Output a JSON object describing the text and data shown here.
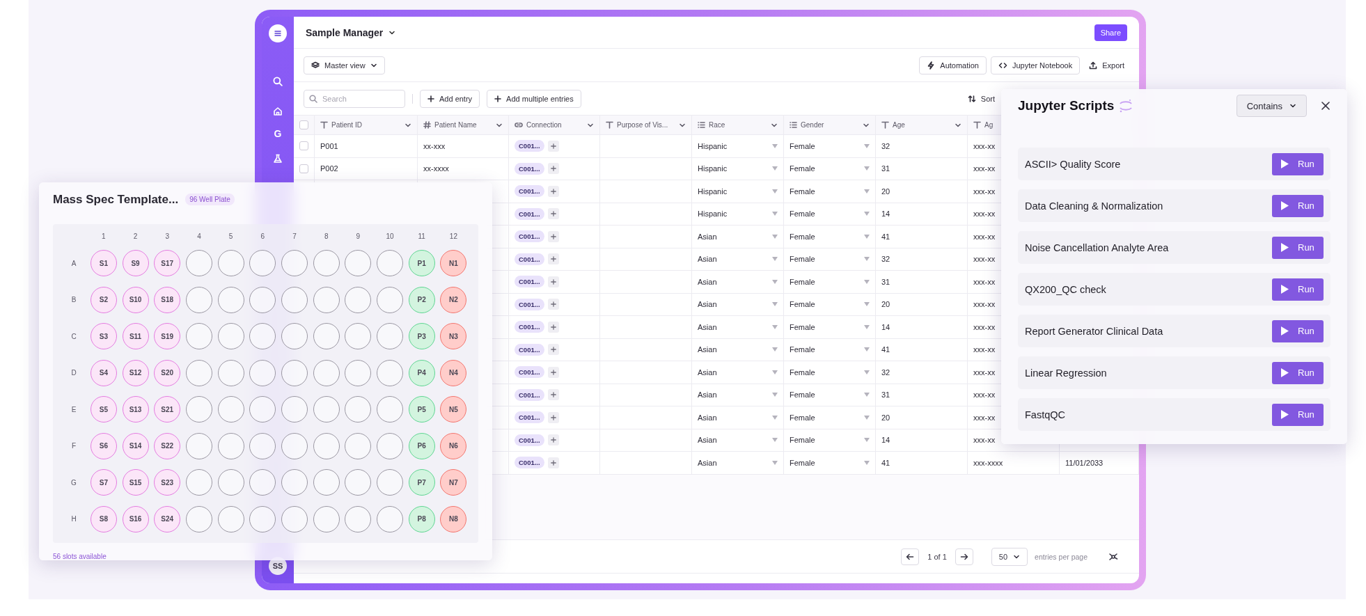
{
  "sidebar": {
    "letter": "G",
    "avatar": "SS"
  },
  "header": {
    "title": "Sample Manager",
    "share": "Share"
  },
  "toolbar": {
    "view": "Master view",
    "actions": [
      {
        "kind": "automation",
        "label": "Automation"
      },
      {
        "kind": "code",
        "label": "Jupyter Notebook"
      },
      {
        "kind": "export",
        "label": "Export"
      }
    ]
  },
  "entry_bar": {
    "search_placeholder": "Search",
    "buttons": [
      "Add entry",
      "Add multiple entries"
    ],
    "sort": "Sort"
  },
  "table": {
    "header_checked": false,
    "columns": [
      {
        "label": "Patient ID",
        "kind": "text"
      },
      {
        "label": "Patient Name",
        "kind": "number"
      },
      {
        "label": "Connection",
        "kind": "link"
      },
      {
        "label": "Purpose of Vis...",
        "kind": "text"
      },
      {
        "label": "Race",
        "kind": "select"
      },
      {
        "label": "Gender",
        "kind": "select"
      },
      {
        "label": "Age",
        "kind": "text"
      },
      {
        "label": "Ag",
        "kind": "text"
      }
    ],
    "rows": [
      {
        "checked": false,
        "patient_id": "P001",
        "patient_name": "xx-xxx",
        "connection": "C001...",
        "race": "Hispanic",
        "gender": "Female",
        "age": "32",
        "column_9": "xxx-xx"
      },
      {
        "checked": false,
        "patient_id": "P002",
        "patient_name": "xx-xxxx",
        "connection": "C001...",
        "race": "Hispanic",
        "gender": "Female",
        "age": "31",
        "column_9": "xxx-xx"
      },
      {
        "connection": "C001...",
        "race": "Hispanic",
        "gender": "Female",
        "age": "20",
        "column_9": "xxx-xx"
      },
      {
        "connection": "C001...",
        "race": "Hispanic",
        "gender": "Female",
        "age": "14",
        "column_9": "xxx-xx"
      },
      {
        "connection": "C001...",
        "race": "Asian",
        "gender": "Female",
        "age": "41",
        "column_9": "xxx-xx"
      },
      {
        "connection": "C001...",
        "race": "Asian",
        "gender": "Female",
        "age": "32",
        "column_9": "xxx-xx"
      },
      {
        "connection": "C001...",
        "race": "Asian",
        "gender": "Female",
        "age": "31",
        "column_9": "xxx-xx"
      },
      {
        "connection": "C001...",
        "race": "Asian",
        "gender": "Female",
        "age": "20",
        "column_9": "xxx-xx"
      },
      {
        "connection": "C001...",
        "race": "Asian",
        "gender": "Female",
        "age": "14",
        "column_9": "xxx-xx"
      },
      {
        "connection": "C001...",
        "race": "Asian",
        "gender": "Female",
        "age": "41",
        "column_9": "xxx-xx"
      },
      {
        "connection": "C001...",
        "race": "Asian",
        "gender": "Female",
        "age": "32",
        "column_9": "xxx-xx"
      },
      {
        "connection": "C001...",
        "race": "Asian",
        "gender": "Female",
        "age": "31",
        "column_9": "xxx-xx"
      },
      {
        "connection": "C001...",
        "race": "Asian",
        "gender": "Female",
        "age": "20",
        "column_9": "xxx-xx"
      },
      {
        "connection": "C001...",
        "race": "Asian",
        "gender": "Female",
        "age": "14",
        "column_9": "xxx-xx"
      },
      {
        "connection": "C001...",
        "race": "Asian",
        "gender": "Female",
        "age": "41",
        "column_9": "xxx-xxxx",
        "column_10": "11/01/2033"
      }
    ]
  },
  "pagination": {
    "page": "1 of 1",
    "per_page": "50",
    "per_page_label": "entries per page"
  },
  "plate": {
    "title": "Mass Spec Template...",
    "badge": "96 Well Plate",
    "footer": "56 slots available",
    "columns": [
      "1",
      "2",
      "3",
      "4",
      "5",
      "6",
      "7",
      "8",
      "9",
      "10",
      "11",
      "12"
    ],
    "rows": [
      {
        "label": "A",
        "wells": [
          {
            "kind": "sample",
            "label": "S1"
          },
          {
            "kind": "sample",
            "label": "S9"
          },
          {
            "kind": "sample",
            "label": "S17"
          },
          {
            "kind": "empty"
          },
          {
            "kind": "empty"
          },
          {
            "kind": "empty"
          },
          {
            "kind": "empty"
          },
          {
            "kind": "empty"
          },
          {
            "kind": "empty"
          },
          {
            "kind": "empty"
          },
          {
            "kind": "positive",
            "label": "P1"
          },
          {
            "kind": "negative",
            "label": "N1"
          }
        ]
      },
      {
        "label": "B",
        "wells": [
          {
            "kind": "sample",
            "label": "S2"
          },
          {
            "kind": "sample",
            "label": "S10"
          },
          {
            "kind": "sample",
            "label": "S18"
          },
          {
            "kind": "empty"
          },
          {
            "kind": "empty"
          },
          {
            "kind": "empty"
          },
          {
            "kind": "empty"
          },
          {
            "kind": "empty"
          },
          {
            "kind": "empty"
          },
          {
            "kind": "empty"
          },
          {
            "kind": "positive",
            "label": "P2"
          },
          {
            "kind": "negative",
            "label": "N2"
          }
        ]
      },
      {
        "label": "C",
        "wells": [
          {
            "kind": "sample",
            "label": "S3"
          },
          {
            "kind": "sample",
            "label": "S11"
          },
          {
            "kind": "sample",
            "label": "S19"
          },
          {
            "kind": "empty"
          },
          {
            "kind": "empty"
          },
          {
            "kind": "empty"
          },
          {
            "kind": "empty"
          },
          {
            "kind": "empty"
          },
          {
            "kind": "empty"
          },
          {
            "kind": "empty"
          },
          {
            "kind": "positive",
            "label": "P3"
          },
          {
            "kind": "negative",
            "label": "N3"
          }
        ]
      },
      {
        "label": "D",
        "wells": [
          {
            "kind": "sample",
            "label": "S4"
          },
          {
            "kind": "sample",
            "label": "S12"
          },
          {
            "kind": "sample",
            "label": "S20"
          },
          {
            "kind": "empty"
          },
          {
            "kind": "empty"
          },
          {
            "kind": "empty"
          },
          {
            "kind": "empty"
          },
          {
            "kind": "empty"
          },
          {
            "kind": "empty"
          },
          {
            "kind": "empty"
          },
          {
            "kind": "positive",
            "label": "P4"
          },
          {
            "kind": "negative",
            "label": "N4"
          }
        ]
      },
      {
        "label": "E",
        "wells": [
          {
            "kind": "sample",
            "label": "S5"
          },
          {
            "kind": "sample",
            "label": "S13"
          },
          {
            "kind": "sample",
            "label": "S21"
          },
          {
            "kind": "empty"
          },
          {
            "kind": "empty"
          },
          {
            "kind": "empty"
          },
          {
            "kind": "empty"
          },
          {
            "kind": "empty"
          },
          {
            "kind": "empty"
          },
          {
            "kind": "empty"
          },
          {
            "kind": "positive",
            "label": "P5"
          },
          {
            "kind": "negative",
            "label": "N5"
          }
        ]
      },
      {
        "label": "F",
        "wells": [
          {
            "kind": "sample",
            "label": "S6"
          },
          {
            "kind": "sample",
            "label": "S14"
          },
          {
            "kind": "sample",
            "label": "S22"
          },
          {
            "kind": "empty"
          },
          {
            "kind": "empty"
          },
          {
            "kind": "empty"
          },
          {
            "kind": "empty"
          },
          {
            "kind": "empty"
          },
          {
            "kind": "empty"
          },
          {
            "kind": "empty"
          },
          {
            "kind": "positive",
            "label": "P6"
          },
          {
            "kind": "negative",
            "label": "N6"
          }
        ]
      },
      {
        "label": "G",
        "wells": [
          {
            "kind": "sample",
            "label": "S7"
          },
          {
            "kind": "sample",
            "label": "S15"
          },
          {
            "kind": "sample",
            "label": "S23"
          },
          {
            "kind": "empty"
          },
          {
            "kind": "empty"
          },
          {
            "kind": "empty"
          },
          {
            "kind": "empty"
          },
          {
            "kind": "empty"
          },
          {
            "kind": "empty"
          },
          {
            "kind": "empty"
          },
          {
            "kind": "positive",
            "label": "P7"
          },
          {
            "kind": "negative",
            "label": "N7"
          }
        ]
      },
      {
        "label": "H",
        "wells": [
          {
            "kind": "sample",
            "label": "S8"
          },
          {
            "kind": "sample",
            "label": "S16"
          },
          {
            "kind": "sample",
            "label": "S24"
          },
          {
            "kind": "empty"
          },
          {
            "kind": "empty"
          },
          {
            "kind": "empty"
          },
          {
            "kind": "empty"
          },
          {
            "kind": "empty"
          },
          {
            "kind": "empty"
          },
          {
            "kind": "empty"
          },
          {
            "kind": "positive",
            "label": "P8"
          },
          {
            "kind": "negative",
            "label": "N8"
          }
        ]
      }
    ]
  },
  "scripts_panel": {
    "title": "Jupyter Scripts",
    "filter": "Contains",
    "scripts": [
      {
        "name": "ASCII> Quality Score",
        "action": "Run"
      },
      {
        "name": "Data Cleaning & Normalization",
        "action": "Run"
      },
      {
        "name": "Noise Cancellation Analyte Area",
        "action": "Run"
      },
      {
        "name": "QX200_QC check",
        "action": "Run"
      },
      {
        "name": "Report Generator Clinical Data",
        "action": "Run"
      },
      {
        "name": "Linear Regression",
        "action": "Run"
      },
      {
        "name": "FastqQC",
        "action": "Run"
      }
    ]
  }
}
